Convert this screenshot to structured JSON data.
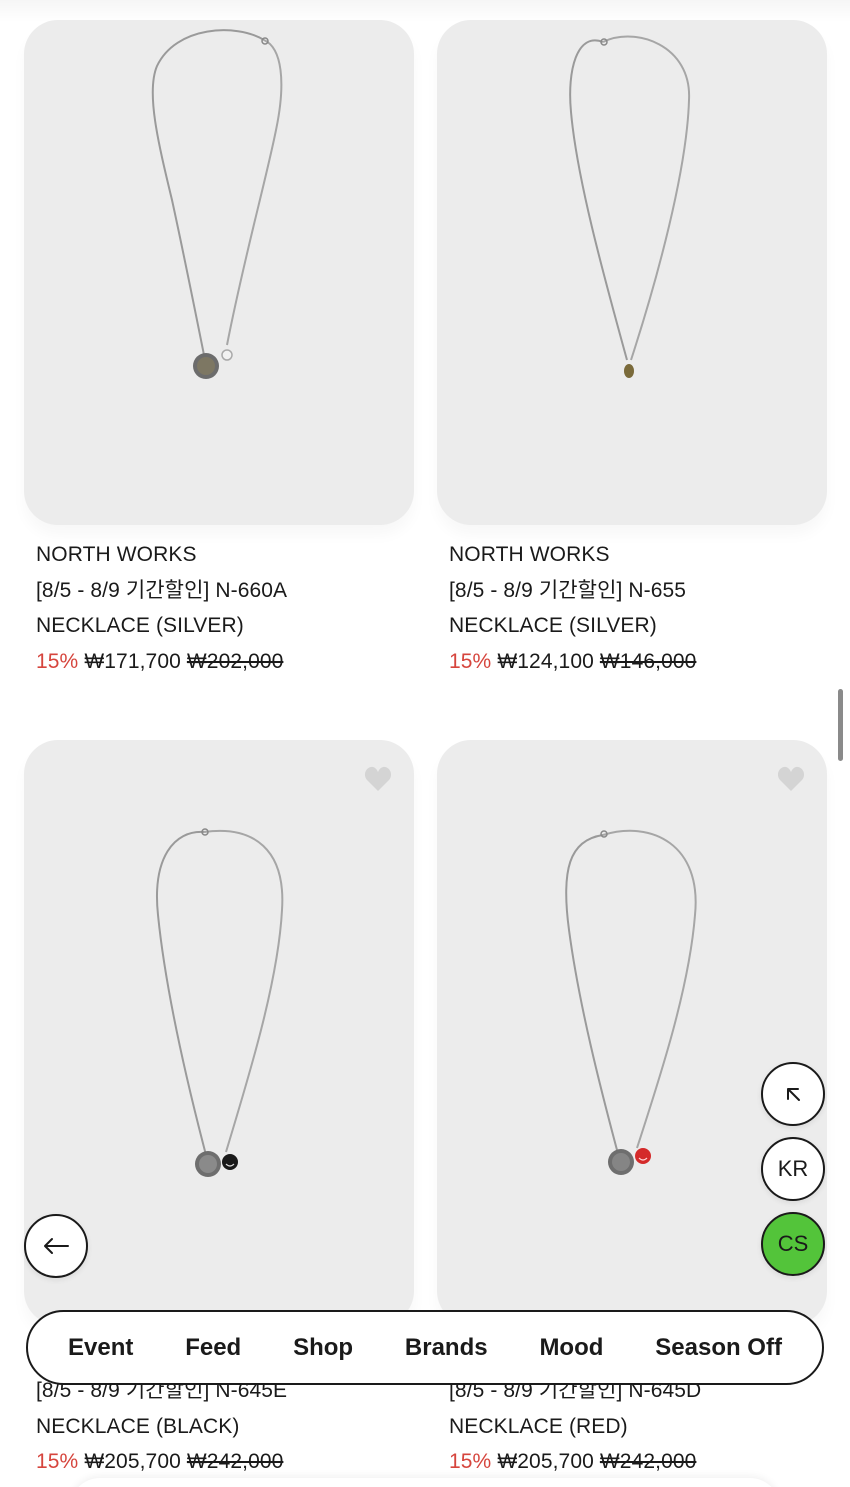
{
  "products": [
    {
      "brand": "NORTH WORKS",
      "name_line1": "[8/5 - 8/9 기간할인] N-660A",
      "name_line2": "NECKLACE (SILVER)",
      "discount": "15%",
      "price": "₩171,700",
      "original_price": "₩202,000",
      "pendant": "silver coin with small charm"
    },
    {
      "brand": "NORTH WORKS",
      "name_line1": "[8/5 - 8/9 기간할인] N-655",
      "name_line2": "NECKLACE (SILVER)",
      "discount": "15%",
      "price": "₩124,100",
      "original_price": "₩146,000",
      "pendant": "small gold nugget"
    },
    {
      "brand": "",
      "name_line1": "[8/5 - 8/9 기간할인] N-645E",
      "name_line2": "NECKLACE (BLACK)",
      "discount": "15%",
      "price": "₩205,700",
      "original_price": "₩242,000",
      "pendant": "silver coin with black smiley charm"
    },
    {
      "brand": "",
      "name_line1": "[8/5 - 8/9 기간할인] N-645D",
      "name_line2": "NECKLACE (RED)",
      "discount": "15%",
      "price": "₩205,700",
      "original_price": "₩242,000",
      "pendant": "silver coin with red smiley charm"
    }
  ],
  "floating_buttons": {
    "scroll_top_icon": "arrow-up-left-icon",
    "language": "KR",
    "customer_service": "CS",
    "back_icon": "arrow-left-icon"
  },
  "nav": [
    "Event",
    "Feed",
    "Shop",
    "Brands",
    "Mood",
    "Season Off"
  ],
  "colors": {
    "discount": "#d6453d",
    "cs_button": "#53c43a",
    "image_bg": "#ececec"
  }
}
